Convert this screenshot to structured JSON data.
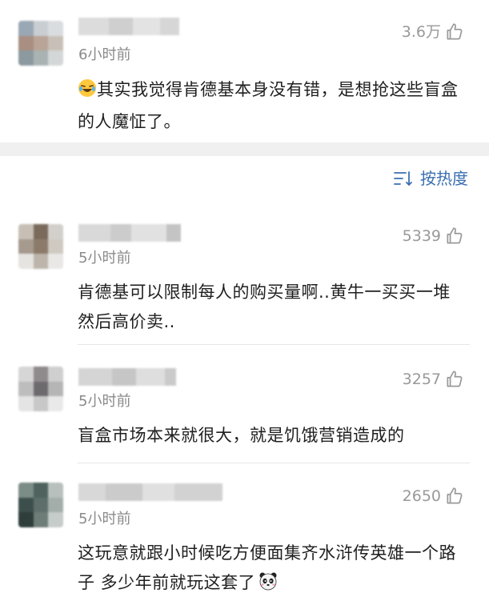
{
  "comments": [
    {
      "time": "6小时前",
      "likes": "3.6万",
      "text": "其实我觉得肯德基本身没有错，是想抢这些盲盒的人魔怔了。",
      "emoji": "laughing-tears-emoji"
    },
    {
      "time": "5小时前",
      "likes": "5339",
      "text": "肯德基可以限制每人的购买量啊..黄牛一买买一堆然后高价卖.."
    },
    {
      "time": "5小时前",
      "likes": "3257",
      "text": "盲盒市场本来就很大，就是饥饿营销造成的"
    },
    {
      "time": "5小时前",
      "likes": "2650",
      "text": "这玩意就跟小时候吃方便面集齐水浒传英雄一个路子 多少年前就玩这套了",
      "emoji": "panda-emoji"
    }
  ],
  "sort": {
    "label": "按热度",
    "icon": "sort-icon"
  },
  "colors": {
    "accent": "#3a6fb0",
    "muted": "#8a8a8a",
    "separator": "#f0f0f0"
  }
}
